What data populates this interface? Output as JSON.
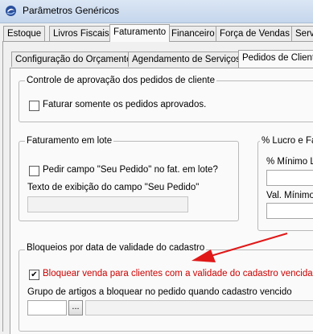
{
  "window": {
    "title": "Parâmetros Genéricos"
  },
  "main_tabs": [
    {
      "label": "Estoque"
    },
    {
      "label": "Livros Fiscais"
    },
    {
      "label": "Faturamento"
    },
    {
      "label": "Financeiro"
    },
    {
      "label": "Força de Vendas"
    },
    {
      "label": "Serv"
    }
  ],
  "sub_tabs": [
    {
      "label": "Configuração do Orçamento"
    },
    {
      "label": "Agendamento de Serviços"
    },
    {
      "label": "Pedidos de Cliente"
    }
  ],
  "approval_group": {
    "legend": "Controle de aprovação dos pedidos de cliente",
    "checkbox_label": "Faturar somente os pedidos aprovados.",
    "checked": false
  },
  "batch_group": {
    "legend": "Faturamento em lote",
    "checkbox_label": "Pedir campo \"Seu Pedido\" no fat. em lote?",
    "checked": false,
    "text_label": "Texto de exibição do campo \"Seu Pedido\"",
    "text_value": ""
  },
  "profit_group": {
    "legend": "% Lucro e Fat",
    "min_label": "% Mínimo Lu",
    "val_label": "Val. Mínimo",
    "min_value": "",
    "val_value": ""
  },
  "validity_group": {
    "legend": "Bloqueios por data de validade do cadastro",
    "checkbox_label": "Bloquear venda para clientes com a validade do cadastro vencida",
    "checked": true,
    "check_mark": "✔",
    "group_label": "Grupo de artigos a bloquear no pedido quando cadastro vencido",
    "browse_label": "...",
    "code_value": "",
    "desc_value": ""
  },
  "colors": {
    "highlight_text": "#cc0000",
    "arrow": "#e01818"
  }
}
